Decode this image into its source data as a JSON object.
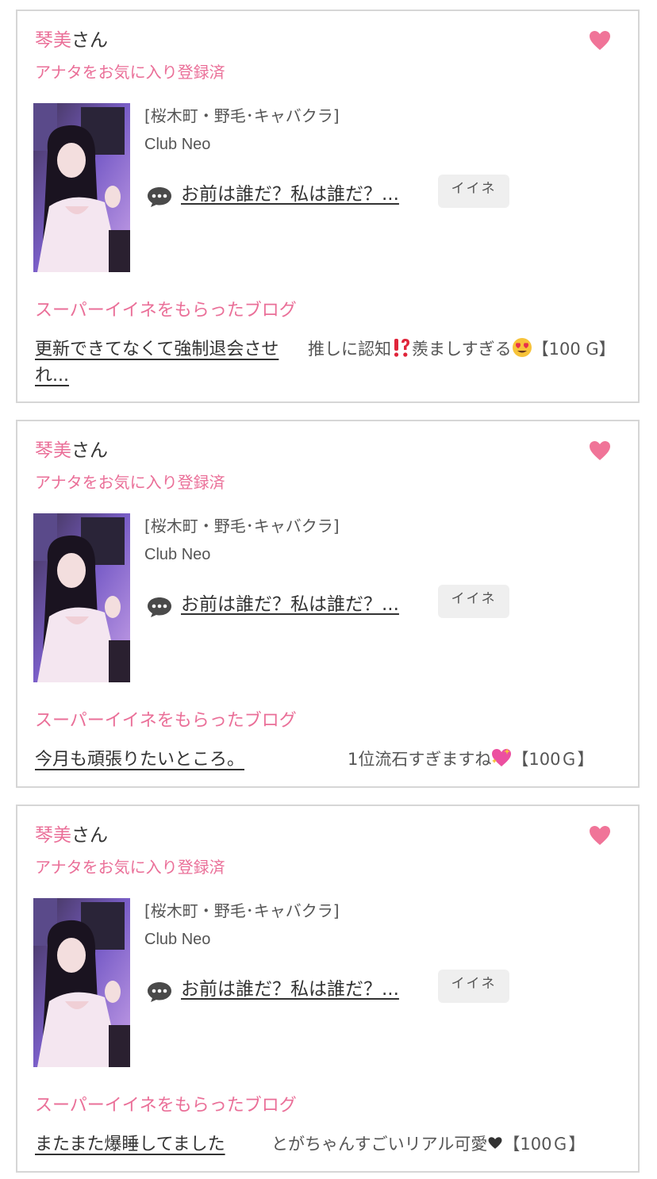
{
  "cards": [
    {
      "user_name": "琴美",
      "user_suffix": "さん",
      "fav_status": "アナタをお気に入り登録済",
      "area": "[桜木町・野毛･キャバクラ]",
      "shop": "Club Neo",
      "blog_title": "お前は誰だ？私は誰だ？...",
      "iine_label": "イイネ",
      "section_title": "スーパーイイネをもらったブログ",
      "post_title": "更新できてなくて強制退会させれ...",
      "comment_text": "推しに認知",
      "comment_mid": "羨ましすぎる",
      "comment_suffix": "【100 G】"
    },
    {
      "user_name": "琴美",
      "user_suffix": "さん",
      "fav_status": "アナタをお気に入り登録済",
      "area": "[桜木町・野毛･キャバクラ]",
      "shop": "Club Neo",
      "blog_title": "お前は誰だ？私は誰だ？...",
      "iine_label": "イイネ",
      "section_title": "スーパーイイネをもらったブログ",
      "post_title": "今月も頑張りたいところ。",
      "comment_text": "1位流石すぎますね",
      "comment_suffix": "【100Ｇ】"
    },
    {
      "user_name": "琴美",
      "user_suffix": "さん",
      "fav_status": "アナタをお気に入り登録済",
      "area": "[桜木町・野毛･キャバクラ]",
      "shop": "Club Neo",
      "blog_title": "お前は誰だ？私は誰だ？...",
      "iine_label": "イイネ",
      "section_title": "スーパーイイネをもらったブログ",
      "post_title": "またまた爆睡してました",
      "comment_text": "とがちゃんすごいリアル可愛",
      "comment_suffix": "【100Ｇ】"
    }
  ],
  "colors": {
    "accent": "#ea6f98",
    "heart": "#f07498",
    "border": "#d6d6d6",
    "button": "#efefef"
  }
}
